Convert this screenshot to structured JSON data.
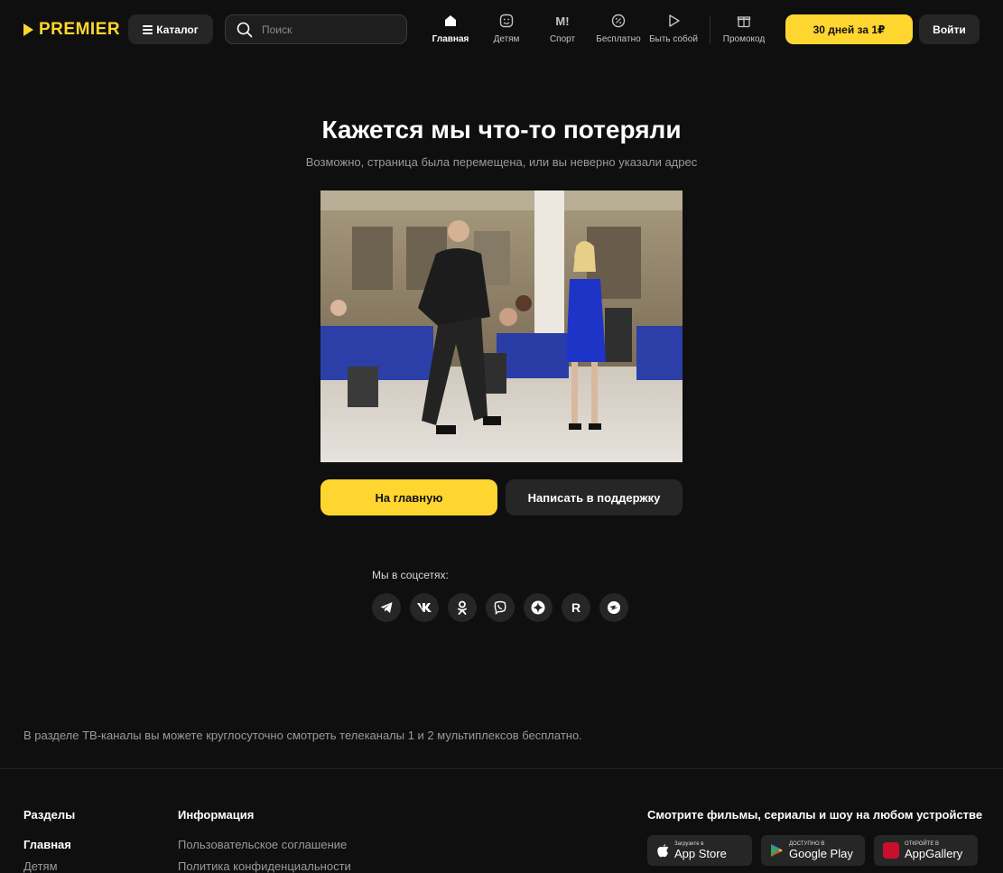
{
  "header": {
    "logo_text": "PREMIER",
    "catalog_label": "Каталог",
    "search_placeholder": "Поиск",
    "nav": [
      {
        "label": "Главная",
        "icon": "home-icon",
        "active": true
      },
      {
        "label": "Детям",
        "icon": "kids-face-icon",
        "active": false
      },
      {
        "label": "Спорт",
        "icon": "sport-icon",
        "active": false
      },
      {
        "label": "Бесплатно",
        "icon": "free-percent-icon",
        "active": false
      },
      {
        "label": "Быть собой",
        "icon": "play-icon",
        "active": false
      },
      {
        "label": "Промокод",
        "icon": "gift-icon",
        "active": false
      }
    ],
    "promo_label": "30 дней за 1₽",
    "login_label": "Войти"
  },
  "main": {
    "title": "Кажется мы что-то потеряли",
    "subtitle": "Возможно, страница была перемещена, или вы неверно указали адрес",
    "home_button": "На главную",
    "support_button": "Написать в поддержку",
    "social_label": "Мы в соцсетях:",
    "socials": [
      "telegram-icon",
      "vk-icon",
      "odnoklassniki-icon",
      "viber-icon",
      "dzen-icon",
      "rutube-icon",
      "yappy-icon"
    ],
    "socials_text": {
      "rutube": "R"
    },
    "info_text": "В разделе ТВ-каналы вы можете круглосуточно смотреть телеканалы 1 и 2 мультиплексов бесплатно."
  },
  "footer": {
    "sections_title": "Разделы",
    "sections_link_1": "Главная",
    "sections_link_2": "Детям",
    "info_title": "Информация",
    "info_link_1": "Пользовательское соглашение",
    "info_link_2": "Политика конфиденциальности",
    "devices_title": "Смотрите фильмы, сериалы и шоу на любом устройстве",
    "appstore_small": "Загрузите в",
    "appstore_big": "App Store",
    "googleplay_small": "ДОСТУПНО В",
    "googleplay_big": "Google Play",
    "appgallery_small": "ОТКРОЙТЕ В",
    "appgallery_big": "AppGallery"
  },
  "colors": {
    "accent": "#ffd630",
    "background": "#0f0f0f",
    "button_dark": "#262626"
  }
}
